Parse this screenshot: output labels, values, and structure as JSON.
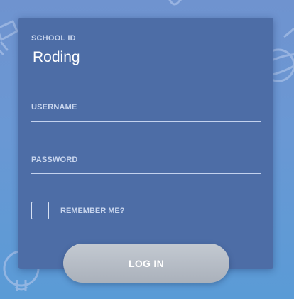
{
  "form": {
    "school_id": {
      "label": "SCHOOL ID",
      "value": "Roding"
    },
    "username": {
      "label": "USERNAME",
      "value": ""
    },
    "password": {
      "label": "PASSWORD",
      "value": ""
    },
    "remember_me": {
      "label": "REMEMBER ME?",
      "checked": false
    },
    "login_button": {
      "label": "LOG IN"
    }
  },
  "colors": {
    "background_top": "#6f93cf",
    "background_bottom": "#5a9bd6",
    "card": "#4d6da6",
    "button": "#b6bcc5"
  },
  "decorations": [
    "lightbulb-doodle",
    "planet-doodle",
    "pencil-doodle",
    "lightbulb-doodle-bottom"
  ]
}
